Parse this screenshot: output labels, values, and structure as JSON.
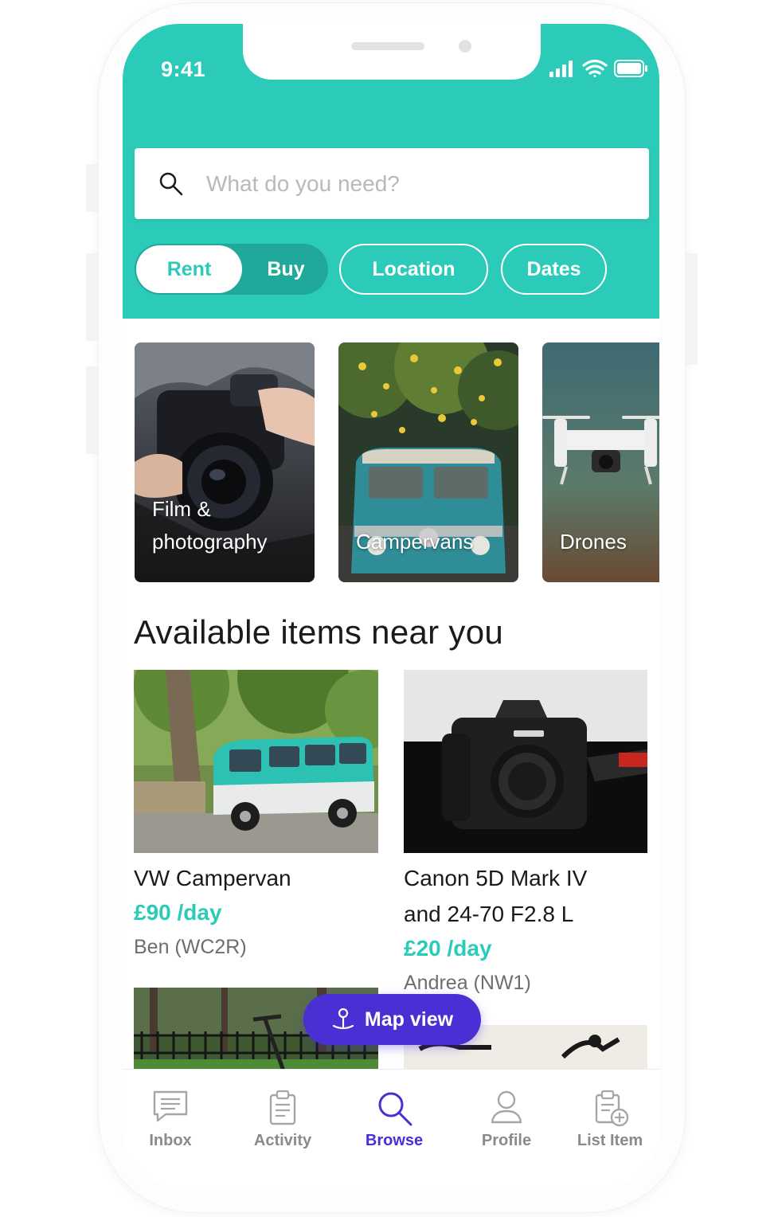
{
  "status_bar": {
    "time": "9:41"
  },
  "search": {
    "placeholder": "What do you need?"
  },
  "filters": {
    "mode_options": [
      "Rent",
      "Buy"
    ],
    "location_label": "Location",
    "dates_label": "Dates"
  },
  "categories": [
    {
      "label_line1": "Film &",
      "label_line2": "photography"
    },
    {
      "label": "Campervans"
    },
    {
      "label": "Drones"
    }
  ],
  "section_title": "Available items near you",
  "items": [
    {
      "title": "VW Campervan",
      "price": "£90 /day",
      "owner": "Ben (WC2R)"
    },
    {
      "title_line1": "Canon 5D Mark IV",
      "title_line2": "and 24-70 F2.8 L",
      "price": "£20 /day",
      "owner": "Andrea (NW1)"
    }
  ],
  "map_button": {
    "label": "Map view"
  },
  "tabs": [
    {
      "label": "Inbox"
    },
    {
      "label": "Activity"
    },
    {
      "label": "Browse"
    },
    {
      "label": "Profile"
    },
    {
      "label": "List Item"
    }
  ],
  "colors": {
    "brand_teal": "#2ccbb9",
    "accent_purple": "#4a2fd4",
    "text_dark": "#1a1a1a",
    "muted": "#8a8a8a"
  }
}
